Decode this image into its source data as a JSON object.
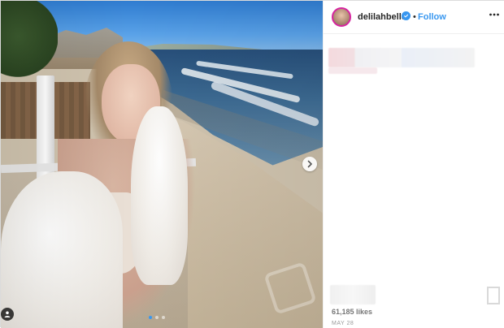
{
  "post": {
    "username": "delilahbelle",
    "follow_label": "Follow",
    "bullet": "•",
    "likes": "61,185 likes",
    "date": "MAY 28"
  },
  "carousel": {
    "dots": 3,
    "active_index": 0
  },
  "colors": {
    "link_blue": "#3897f0",
    "text_dark": "#262626",
    "divider": "#efefef"
  },
  "icons": {
    "verified": "verified-badge-icon",
    "more": "more-options-icon",
    "next": "chevron-right-icon",
    "tag": "user-tag-icon",
    "save": "bookmark-icon"
  }
}
